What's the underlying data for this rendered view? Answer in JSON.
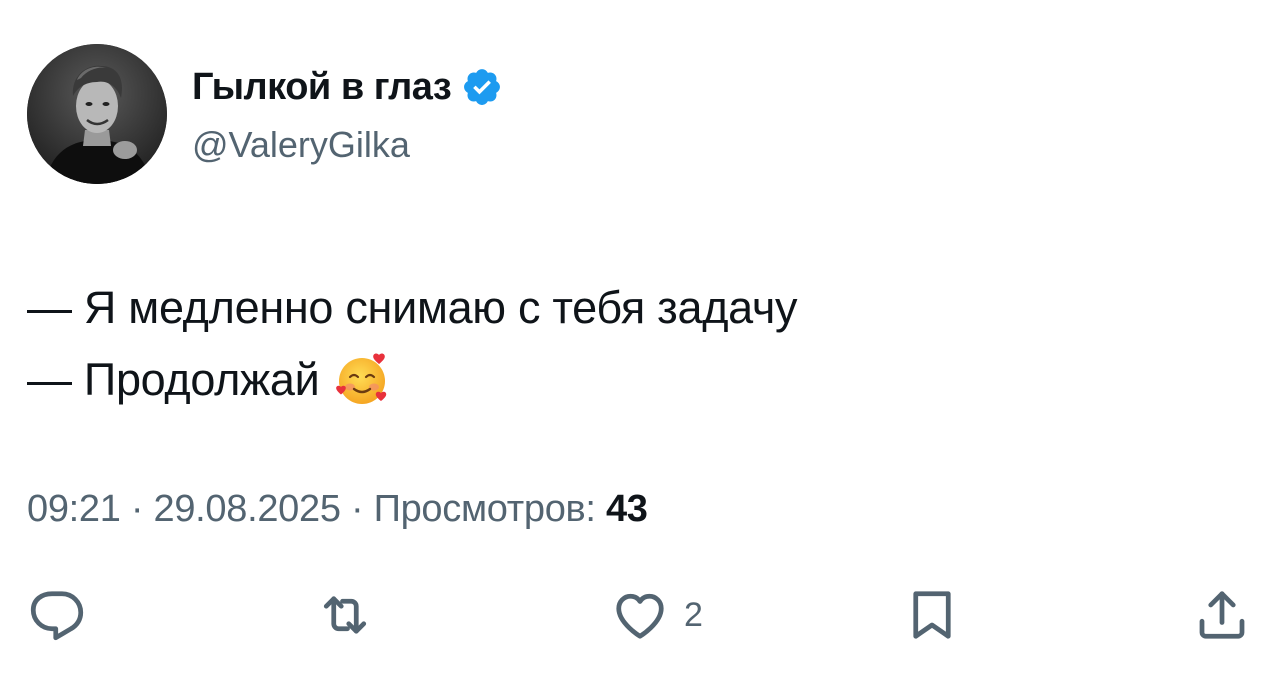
{
  "author": {
    "display_name": "Гылкой в глаз",
    "handle": "@ValeryGilka",
    "verified_icon": "verified-badge-icon",
    "verified_color": "#1d9bf0"
  },
  "tweet": {
    "lines": [
      "— Я медленно снимаю с тебя задачу",
      "— Продолжай"
    ],
    "emoji": "smiling-face-with-hearts-emoji"
  },
  "meta": {
    "time": "09:21",
    "separator": "·",
    "date": "29.08.2025",
    "views_label": "Просмотров:",
    "views_count": "43"
  },
  "actions": {
    "reply_icon": "reply-icon",
    "retweet_icon": "retweet-icon",
    "like_icon": "heart-icon",
    "like_count": "2",
    "bookmark_icon": "bookmark-icon",
    "share_icon": "share-icon"
  },
  "colors": {
    "text": "#0f1419",
    "secondary": "#536471",
    "accent": "#1d9bf0"
  }
}
